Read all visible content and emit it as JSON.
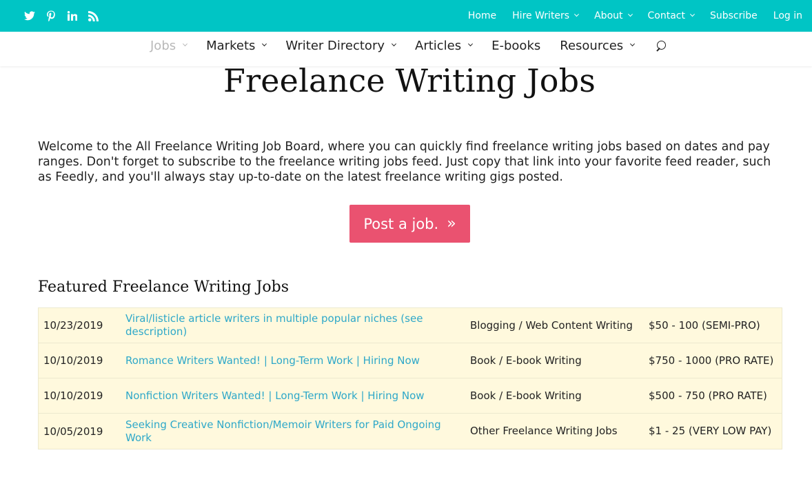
{
  "topbar": {
    "social_icons": [
      "twitter-icon",
      "pinterest-icon",
      "linkedin-icon",
      "rss-icon"
    ],
    "nav": [
      {
        "label": "Home",
        "has_dropdown": false
      },
      {
        "label": "Hire Writers",
        "has_dropdown": true
      },
      {
        "label": "About",
        "has_dropdown": true
      },
      {
        "label": "Contact",
        "has_dropdown": true
      },
      {
        "label": "Subscribe",
        "has_dropdown": false
      },
      {
        "label": "Log in",
        "has_dropdown": false
      }
    ],
    "color": "#00c5c5"
  },
  "mainnav": {
    "items": [
      {
        "label": "Jobs",
        "has_dropdown": true,
        "active": true
      },
      {
        "label": "Markets",
        "has_dropdown": true
      },
      {
        "label": "Writer Directory",
        "has_dropdown": true
      },
      {
        "label": "Articles",
        "has_dropdown": true
      },
      {
        "label": "E-books",
        "has_dropdown": false
      },
      {
        "label": "Resources",
        "has_dropdown": true
      }
    ],
    "search_icon": "search-icon"
  },
  "page": {
    "title": "Freelance Writing Jobs",
    "intro": "Welcome to the All Freelance Writing Job Board, where you can quickly find freelance writing jobs based on dates and pay ranges. Don't forget to subscribe to the freelance writing jobs feed. Just copy that link into your favorite feed reader, such as Feedly, and you'll always stay up-to-date on the latest freelance writing gigs posted.",
    "post_button": {
      "label": "Post a job.",
      "arrow": "»",
      "color": "#ea5270"
    },
    "featured_heading": "Featured Freelance Writing Jobs"
  },
  "jobs": [
    {
      "date": "10/23/2019",
      "title": "Viral/listicle article writers in multiple popular niches (see description)",
      "category": "Blogging / Web Content Writing",
      "pay": "$50 - 100 (SEMI-PRO)"
    },
    {
      "date": "10/10/2019",
      "title": "Romance Writers Wanted! | Long-Term Work | Hiring Now",
      "category": "Book / E-book Writing",
      "pay": "$750 - 1000 (PRO RATE)"
    },
    {
      "date": "10/10/2019",
      "title": "Nonfiction Writers Wanted! | Long-Term Work | Hiring Now",
      "category": "Book / E-book Writing",
      "pay": "$500 - 750 (PRO RATE)"
    },
    {
      "date": "10/05/2019",
      "title": "Seeking Creative Nonfiction/Memoir Writers for Paid Ongoing Work",
      "category": "Other Freelance Writing Jobs",
      "pay": "$1 - 25 (VERY LOW PAY)"
    }
  ]
}
